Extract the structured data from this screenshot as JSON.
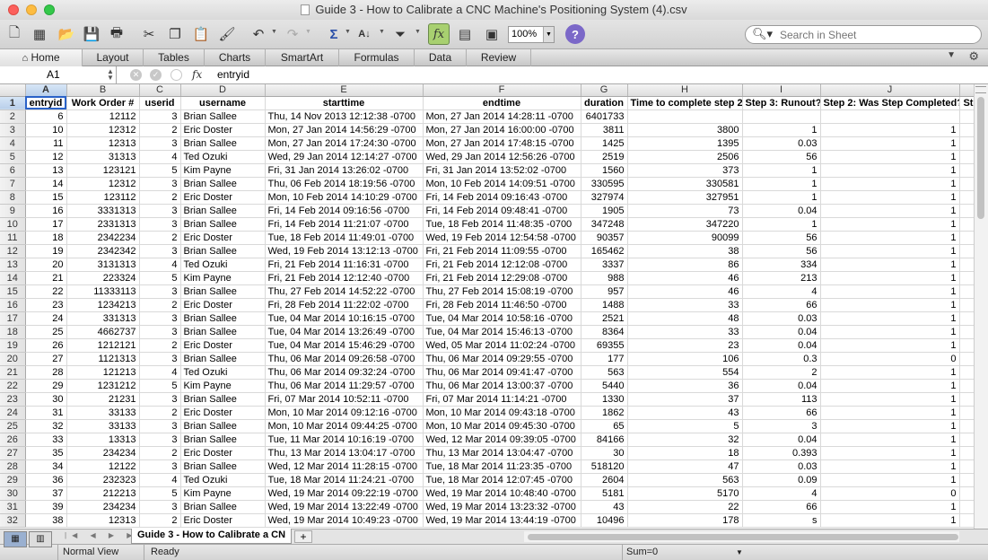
{
  "window": {
    "title": "Guide 3 - How to Calibrate a CNC Machine's Positioning System (4).csv"
  },
  "toolbar": {
    "zoom": "100%",
    "search_placeholder": "Search in Sheet"
  },
  "ribbon": {
    "tabs": [
      "Home",
      "Layout",
      "Tables",
      "Charts",
      "SmartArt",
      "Formulas",
      "Data",
      "Review"
    ]
  },
  "formula_bar": {
    "cell_ref": "A1",
    "content": "entryid"
  },
  "grid": {
    "col_letters": [
      "A",
      "B",
      "C",
      "D",
      "E",
      "F",
      "G",
      "H",
      "I",
      "J",
      ""
    ],
    "headers": [
      "entryid",
      "Work Order #",
      "userid",
      "username",
      "starttime",
      "endtime",
      "duration",
      "Time to complete step 2",
      "Step 3: Runout?",
      "Step 2: Was Step Completed?",
      "Ste"
    ],
    "rows": [
      [
        "6",
        "12112",
        "3",
        "Brian Sallee",
        "Thu, 14 Nov 2013 12:12:38 -0700",
        "Mon, 27 Jan 2014 14:28:11 -0700",
        "6401733",
        "",
        "",
        "",
        ""
      ],
      [
        "10",
        "12312",
        "2",
        "Eric Doster",
        "Mon, 27 Jan 2014 14:56:29 -0700",
        "Mon, 27 Jan 2014 16:00:00 -0700",
        "3811",
        "3800",
        "1",
        "1",
        ""
      ],
      [
        "11",
        "12313",
        "3",
        "Brian Sallee",
        "Mon, 27 Jan 2014 17:24:30 -0700",
        "Mon, 27 Jan 2014 17:48:15 -0700",
        "1425",
        "1395",
        "0.03",
        "1",
        ""
      ],
      [
        "12",
        "31313",
        "4",
        "Ted Ozuki",
        "Wed, 29 Jan 2014 12:14:27 -0700",
        "Wed, 29 Jan 2014 12:56:26 -0700",
        "2519",
        "2506",
        "56",
        "1",
        ""
      ],
      [
        "13",
        "123121",
        "5",
        "Kim Payne",
        "Fri, 31 Jan 2014 13:26:02 -0700",
        "Fri, 31 Jan 2014 13:52:02 -0700",
        "1560",
        "373",
        "1",
        "1",
        ""
      ],
      [
        "14",
        "12312",
        "3",
        "Brian Sallee",
        "Thu, 06 Feb 2014 18:19:56 -0700",
        "Mon, 10 Feb 2014 14:09:51 -0700",
        "330595",
        "330581",
        "1",
        "1",
        ""
      ],
      [
        "15",
        "123112",
        "2",
        "Eric Doster",
        "Mon, 10 Feb 2014 14:10:29 -0700",
        "Fri, 14 Feb 2014 09:16:43 -0700",
        "327974",
        "327951",
        "1",
        "1",
        ""
      ],
      [
        "16",
        "3331313",
        "3",
        "Brian Sallee",
        "Fri, 14 Feb 2014 09:16:56 -0700",
        "Fri, 14 Feb 2014 09:48:41 -0700",
        "1905",
        "73",
        "0.04",
        "1",
        ""
      ],
      [
        "17",
        "2331313",
        "3",
        "Brian Sallee",
        "Fri, 14 Feb 2014 11:21:07 -0700",
        "Tue, 18 Feb 2014 11:48:35 -0700",
        "347248",
        "347220",
        "1",
        "1",
        ""
      ],
      [
        "18",
        "2342234",
        "2",
        "Eric Doster",
        "Tue, 18 Feb 2014 11:49:01 -0700",
        "Wed, 19 Feb 2014 12:54:58 -0700",
        "90357",
        "90099",
        "56",
        "1",
        ""
      ],
      [
        "19",
        "2342342",
        "3",
        "Brian Sallee",
        "Wed, 19 Feb 2014 13:12:13 -0700",
        "Fri, 21 Feb 2014 11:09:55 -0700",
        "165462",
        "38",
        "56",
        "1",
        ""
      ],
      [
        "20",
        "3131313",
        "4",
        "Ted Ozuki",
        "Fri, 21 Feb 2014 11:16:31 -0700",
        "Fri, 21 Feb 2014 12:12:08 -0700",
        "3337",
        "86",
        "334",
        "1",
        ""
      ],
      [
        "21",
        "223324",
        "5",
        "Kim Payne",
        "Fri, 21 Feb 2014 12:12:40 -0700",
        "Fri, 21 Feb 2014 12:29:08 -0700",
        "988",
        "46",
        "213",
        "1",
        ""
      ],
      [
        "22",
        "11333113",
        "3",
        "Brian Sallee",
        "Thu, 27 Feb 2014 14:52:22 -0700",
        "Thu, 27 Feb 2014 15:08:19 -0700",
        "957",
        "46",
        "4",
        "1",
        ""
      ],
      [
        "23",
        "1234213",
        "2",
        "Eric Doster",
        "Fri, 28 Feb 2014 11:22:02 -0700",
        "Fri, 28 Feb 2014 11:46:50 -0700",
        "1488",
        "33",
        "66",
        "1",
        ""
      ],
      [
        "24",
        "331313",
        "3",
        "Brian Sallee",
        "Tue, 04 Mar 2014 10:16:15 -0700",
        "Tue, 04 Mar 2014 10:58:16 -0700",
        "2521",
        "48",
        "0.03",
        "1",
        ""
      ],
      [
        "25",
        "4662737",
        "3",
        "Brian Sallee",
        "Tue, 04 Mar 2014 13:26:49 -0700",
        "Tue, 04 Mar 2014 15:46:13 -0700",
        "8364",
        "33",
        "0.04",
        "1",
        ""
      ],
      [
        "26",
        "1212121",
        "2",
        "Eric Doster",
        "Tue, 04 Mar 2014 15:46:29 -0700",
        "Wed, 05 Mar 2014 11:02:24 -0700",
        "69355",
        "23",
        "0.04",
        "1",
        ""
      ],
      [
        "27",
        "1121313",
        "3",
        "Brian Sallee",
        "Thu, 06 Mar 2014 09:26:58 -0700",
        "Thu, 06 Mar 2014 09:29:55 -0700",
        "177",
        "106",
        "0.3",
        "0",
        ""
      ],
      [
        "28",
        "121213",
        "4",
        "Ted Ozuki",
        "Thu, 06 Mar 2014 09:32:24 -0700",
        "Thu, 06 Mar 2014 09:41:47 -0700",
        "563",
        "554",
        "2",
        "1",
        ""
      ],
      [
        "29",
        "1231212",
        "5",
        "Kim Payne",
        "Thu, 06 Mar 2014 11:29:57 -0700",
        "Thu, 06 Mar 2014 13:00:37 -0700",
        "5440",
        "36",
        "0.04",
        "1",
        ""
      ],
      [
        "30",
        "21231",
        "3",
        "Brian Sallee",
        "Fri, 07 Mar 2014 10:52:11 -0700",
        "Fri, 07 Mar 2014 11:14:21 -0700",
        "1330",
        "37",
        "113",
        "1",
        ""
      ],
      [
        "31",
        "33133",
        "2",
        "Eric Doster",
        "Mon, 10 Mar 2014 09:12:16 -0700",
        "Mon, 10 Mar 2014 09:43:18 -0700",
        "1862",
        "43",
        "66",
        "1",
        ""
      ],
      [
        "32",
        "33133",
        "3",
        "Brian Sallee",
        "Mon, 10 Mar 2014 09:44:25 -0700",
        "Mon, 10 Mar 2014 09:45:30 -0700",
        "65",
        "5",
        "3",
        "1",
        ""
      ],
      [
        "33",
        "13313",
        "3",
        "Brian Sallee",
        "Tue, 11 Mar 2014 10:16:19 -0700",
        "Wed, 12 Mar 2014 09:39:05 -0700",
        "84166",
        "32",
        "0.04",
        "1",
        ""
      ],
      [
        "35",
        "234234",
        "2",
        "Eric Doster",
        "Thu, 13 Mar 2014 13:04:17 -0700",
        "Thu, 13 Mar 2014 13:04:47 -0700",
        "30",
        "18",
        "0.393",
        "1",
        ""
      ],
      [
        "34",
        "12122",
        "3",
        "Brian Sallee",
        "Wed, 12 Mar 2014 11:28:15 -0700",
        "Tue, 18 Mar 2014 11:23:35 -0700",
        "518120",
        "47",
        "0.03",
        "1",
        ""
      ],
      [
        "36",
        "232323",
        "4",
        "Ted Ozuki",
        "Tue, 18 Mar 2014 11:24:21 -0700",
        "Tue, 18 Mar 2014 12:07:45 -0700",
        "2604",
        "563",
        "0.09",
        "1",
        ""
      ],
      [
        "37",
        "212213",
        "5",
        "Kim Payne",
        "Wed, 19 Mar 2014 09:22:19 -0700",
        "Wed, 19 Mar 2014 10:48:40 -0700",
        "5181",
        "5170",
        "4",
        "0",
        ""
      ],
      [
        "39",
        "234234",
        "3",
        "Brian Sallee",
        "Wed, 19 Mar 2014 13:22:49 -0700",
        "Wed, 19 Mar 2014 13:23:32 -0700",
        "43",
        "22",
        "66",
        "1",
        ""
      ],
      [
        "38",
        "12313",
        "2",
        "Eric Doster",
        "Wed, 19 Mar 2014 10:49:23 -0700",
        "Wed, 19 Mar 2014 13:44:19 -0700",
        "10496",
        "178",
        "s",
        "1",
        ""
      ]
    ]
  },
  "sheet_tabs": {
    "active": "Guide 3 - How to Calibrate a CN"
  },
  "status": {
    "view": "Normal View",
    "mode": "Ready",
    "sum": "Sum=0"
  }
}
